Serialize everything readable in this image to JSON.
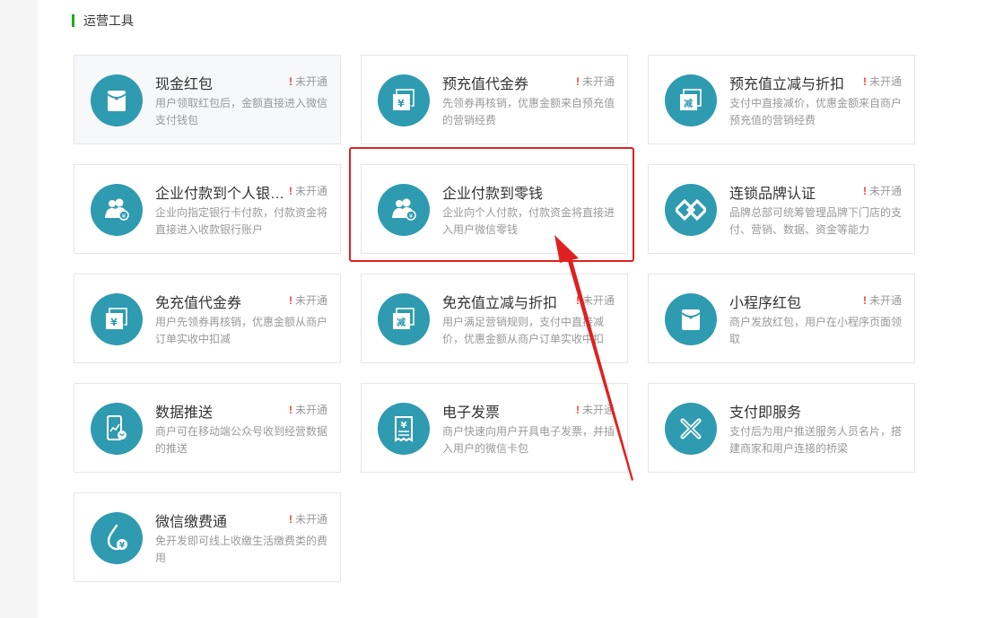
{
  "section": {
    "title": "运营工具"
  },
  "cards": [
    {
      "title": "现金红包",
      "status": "未开通",
      "desc": "用户领取红包后，金额直接进入微信支付钱包",
      "icon": "red-packet-icon"
    },
    {
      "title": "预充值代金券",
      "status": "未开通",
      "desc": "先领券再核销，优惠金额来自预充值的营销经费",
      "icon": "yuan-voucher-icon"
    },
    {
      "title": "预充值立减与折扣",
      "status": "未开通",
      "desc": "支付中直接减价，优惠金额来自商户预充值的营销经费",
      "icon": "discount-voucher-icon",
      "glyph": "减"
    },
    {
      "title": "企业付款到个人银行卡",
      "status": "未开通",
      "desc": "企业向指定银行卡付款，付款资金将直接进入收款银行账户",
      "icon": "people-payment-icon"
    },
    {
      "title": "企业付款到零钱",
      "status": "",
      "desc": "企业向个人付款，付款资金将直接进入用户微信零钱",
      "icon": "people-payment-icon"
    },
    {
      "title": "连锁品牌认证",
      "status": "未开通",
      "desc": "品牌总部可统筹管理品牌下门店的支付、营销、数据、资金等能力",
      "icon": "chain-link-icon"
    },
    {
      "title": "免充值代金券",
      "status": "未开通",
      "desc": "用户先领券再核销，优惠金额从商户订单实收中扣减",
      "icon": "yuan-voucher-icon"
    },
    {
      "title": "免充值立减与折扣",
      "status": "未开通",
      "desc": "用户满足营销规则，支付中直接减价，优惠金额从商户订单实收中扣",
      "icon": "discount-voucher-icon",
      "glyph": "减"
    },
    {
      "title": "小程序红包",
      "status": "未开通",
      "desc": "商户发放红包，用户在小程序页面领取",
      "icon": "red-packet-icon"
    },
    {
      "title": "数据推送",
      "status": "未开通",
      "desc": "商户可在移动端公众号收到经营数据的推送",
      "icon": "mobile-chart-icon"
    },
    {
      "title": "电子发票",
      "status": "未开通",
      "desc": "商户快速向用户开具电子发票，并插入用户的微信卡包",
      "icon": "invoice-icon",
      "glyph": "¥"
    },
    {
      "title": "支付即服务",
      "status": "",
      "desc": "支付后为用户推送服务人员名片，搭建商家和用户连接的桥梁",
      "icon": "cross-link-icon"
    },
    {
      "title": "微信缴费通",
      "status": "未开通",
      "desc": "免开发即可线上收缴生活缴费类的费用",
      "icon": "bill-payment-icon",
      "glyph": "¥"
    }
  ],
  "colors": {
    "accent": "#1aad19",
    "icon_bg": "#2f9bb0",
    "alert": "#e64340",
    "highlight": "#e02020"
  }
}
